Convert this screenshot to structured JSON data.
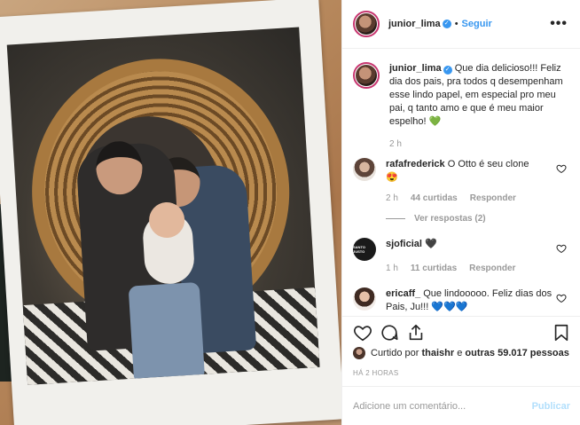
{
  "post": {
    "image_alt": "Polaroid photo of two men with a baby sitting in a wicker chair"
  },
  "header": {
    "username": "junior_lima",
    "separator": "•",
    "follow_label": "Seguir",
    "more_label": "•••"
  },
  "caption": {
    "username": "junior_lima",
    "text": "Que dia delicioso!!! Feliz dia dos pais, pra todos q desempenham esse lindo papel, em especial pro meu pai, q tanto amo e que é meu maior espelho!",
    "emoji": "💚",
    "time": "2 h"
  },
  "comments": [
    {
      "username": "rafafrederick",
      "text": "O Otto é seu clone",
      "emoji": "😍",
      "time": "2 h",
      "likes": "44 curtidas",
      "reply_label": "Responder",
      "view_replies": "Ver respostas (2)"
    },
    {
      "username": "sjoficial",
      "avatar_text": "SANTO JUSTO",
      "text": "",
      "emoji": "🖤",
      "time": "1 h",
      "likes": "11 curtidas",
      "reply_label": "Responder"
    },
    {
      "username": "ericaff_",
      "text": "Que lindooooo. Feliz dias dos Pais, Ju!!!",
      "emoji": "💙💙💙"
    }
  ],
  "actions": {
    "like": "heart-icon",
    "comment": "comment-icon",
    "share": "share-icon",
    "save": "bookmark-icon"
  },
  "likes": {
    "prefix": "Curtido por",
    "user": "thaishr",
    "middle": "e",
    "others": "outras 59.017 pessoas"
  },
  "timestamp": "HÁ 2 HORAS",
  "add_comment": {
    "placeholder": "Adicione um comentário...",
    "publish_label": "Publicar"
  },
  "colors": {
    "accent": "#3897f0",
    "muted": "#999999",
    "publish_disabled": "#b2dffc"
  }
}
